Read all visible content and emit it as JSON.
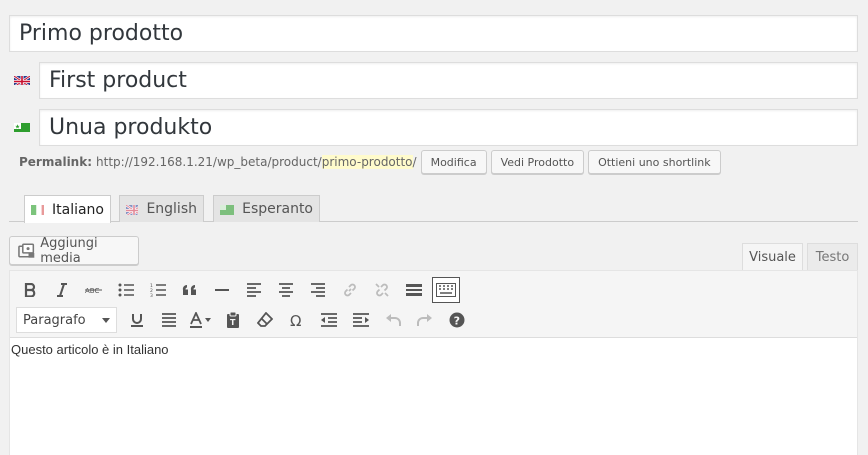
{
  "titles": {
    "italian": "Primo prodotto",
    "english": "First product",
    "esperanto": "Unua produkto"
  },
  "permalink": {
    "label": "Permalink:",
    "url_prefix": "http://192.168.1.21/wp_beta/product/",
    "slug": "primo-prodotto",
    "url_suffix": "/",
    "buttons": [
      "Modifica",
      "Vedi Prodotto",
      "Ottieni uno shortlink"
    ]
  },
  "language_tabs": [
    {
      "label": "Italiano",
      "active": true,
      "flag": "italy-flag-icon"
    },
    {
      "label": "English",
      "active": false,
      "flag": "uk-flag-icon"
    },
    {
      "label": "Esperanto",
      "active": false,
      "flag": "esperanto-flag-icon"
    }
  ],
  "media_button": "Aggiungi media",
  "editor_modes": {
    "visual": "Visuale",
    "text": "Testo",
    "active": "visual"
  },
  "toolbar": {
    "row1_icons": [
      "bold-icon",
      "italic-icon",
      "strikethrough-icon",
      "bullet-list-icon",
      "numbered-list-icon",
      "blockquote-icon",
      "horizontal-line-icon",
      "align-left-icon",
      "align-center-icon",
      "align-right-icon",
      "link-icon",
      "unlink-icon",
      "read-more-icon",
      "toolbar-toggle-icon"
    ],
    "format_select": "Paragrafo",
    "row2_icons": [
      "underline-icon",
      "justify-icon",
      "text-color-icon",
      "paste-text-icon",
      "clear-formatting-icon",
      "special-character-icon",
      "outdent-icon",
      "indent-icon",
      "undo-icon",
      "redo-icon",
      "help-icon"
    ]
  },
  "editor_content": "Questo articolo è in Italiano"
}
